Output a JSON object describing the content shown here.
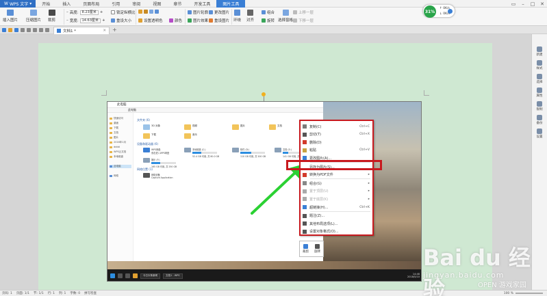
{
  "app": {
    "name": "WPS 文字"
  },
  "menu": [
    "开始",
    "插入",
    "页面布局",
    "引用",
    "审阅",
    "视图",
    "章节",
    "开发工具",
    "图片工具"
  ],
  "menu_active_index": 8,
  "ribbon": {
    "insert_pic": "插入图片",
    "compress": "压缩图片",
    "crop": "裁剪",
    "height_label": "高度:",
    "height_value": "8.23厘米",
    "width_label": "宽度:",
    "width_value": "14.63厘米",
    "lock_ratio": "锁定纵横比",
    "reset_size": "重设大小",
    "set_transparent": "设置透明色",
    "color": "颜色",
    "contrast": "图片轮廓",
    "effects": "图片效果",
    "change_pic": "更改图片",
    "reset_pic": "重设图片",
    "wrap": "环绕",
    "align": "对齐",
    "group": "组合",
    "rotate": "旋转",
    "select_pane": "选择窗格",
    "up_one": "上移一层",
    "down_one": "下移一层"
  },
  "tabbar": {
    "doc_title": "文档1 *",
    "add": "+"
  },
  "right_panel": [
    "新建",
    "样式",
    "选择",
    "属性",
    "限制",
    "备份",
    "设置"
  ],
  "status": {
    "page": "页码: 1",
    "pages": "页面: 1/1",
    "section": "节: 1/1",
    "row": "行: 1",
    "col": "列: 1",
    "words": "字数: 0",
    "spell": "拼写检查",
    "zoom": "100 %"
  },
  "speed": {
    "pct": "31%",
    "up": "0K/s",
    "down": "0K/s"
  },
  "explorer": {
    "title": "此电脑",
    "address": "此电脑",
    "nav": [
      "快速访问",
      "桌面",
      "下载",
      "文档",
      "图片",
      "2016年1月",
      "dddd",
      "WPS云文档",
      "本地磁盘",
      "此电脑",
      "网络"
    ],
    "section_folders": "文件夹 (6)",
    "folders": [
      "3D 对象",
      "视频",
      "图片",
      "文档",
      "下载",
      "音乐"
    ],
    "section_drives": "设备和驱动器 (6)",
    "drives": [
      {
        "name": "WPS网盘",
        "info": "双击进入WPS网盘"
      },
      {
        "name": "本地磁盘 (C:)",
        "info": "52.4 GB 可用, 共 80.0 GB",
        "fill": 0.35
      },
      {
        "name": "软件 (D:)",
        "info": "110 GB 可用, 共 200 GB",
        "fill": 0.45
      },
      {
        "name": "文档 (E:)",
        "info": "141 GB 可用, 共 200 GB",
        "fill": 0.3
      },
      {
        "name": "娱乐 (F:)",
        "info": "165 GB 可用, 共 250 GB",
        "fill": 0.35
      },
      {
        "name": "新加卷 (G:)",
        "info": "3.46 GB 可用, 共 10.0 GB",
        "fill": 0.65
      }
    ],
    "section_net": "网络位置 (1)",
    "net_item": "网络设备",
    "net_sub": "Capture Application"
  },
  "taskbar": {
    "apps": [
      "今日头条新闻",
      "文档1 - WPS"
    ],
    "time": "14:48",
    "date": "2018/5/10"
  },
  "context_menu": [
    {
      "label": "复制(C)",
      "key": "Ctrl+C",
      "color": "#7a7a7a"
    },
    {
      "label": "剪切(T)",
      "key": "Ctrl+X",
      "color": "#555555"
    },
    {
      "label": "删除(D)",
      "key": "",
      "color": "#d23b2b"
    },
    {
      "label": "粘贴",
      "key": "Ctrl+V",
      "color": "#c9a241"
    },
    {
      "label": "更改图片(A)...",
      "key": "",
      "color": "#3a7fd5"
    },
    {
      "label": "另存为图片(S)...",
      "key": "",
      "color": ""
    },
    {
      "label": "转换为PDF文件",
      "key": "",
      "color": "#d23b2b",
      "arrow": true
    },
    {
      "label": "组合(G)",
      "key": "",
      "color": "#888",
      "arrow": true
    },
    {
      "label": "置于顶层(U)",
      "key": "",
      "color": "#aaa",
      "arrow": true,
      "disabled": true
    },
    {
      "label": "置于底层(K)",
      "key": "",
      "color": "#aaa",
      "arrow": true,
      "disabled": true
    },
    {
      "label": "超链接(H)...",
      "key": "Ctrl+K",
      "color": "#3a7fd5"
    },
    {
      "label": "题注(Z)...",
      "key": "",
      "color": "#555"
    },
    {
      "label": "其他布局选项(L)...",
      "key": "",
      "color": "#555"
    },
    {
      "label": "设置对象格式(O)...",
      "key": "",
      "color": "#555"
    }
  ],
  "mini_toolbar": {
    "crop": "裁剪",
    "rotate": "旋转"
  },
  "watermark": {
    "brand": "Bai du 经验",
    "url": "jingyan.baidu.com",
    "sub": "OPEN 游戏家园"
  },
  "colors": {
    "accent": "#2f6fc4",
    "highlight_red": "#c8191e",
    "page_bg": "#cfe8d2",
    "arrow_green": "#2bd133"
  }
}
